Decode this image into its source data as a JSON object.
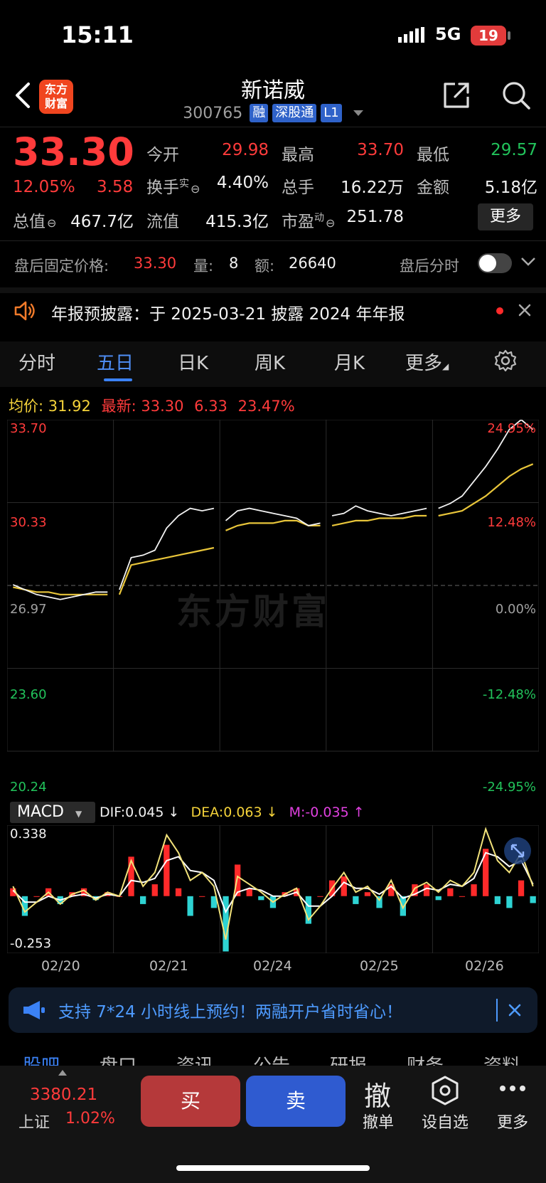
{
  "status_bar": {
    "time": "15:11",
    "network": "5G",
    "battery": "19"
  },
  "header": {
    "logo_line1": "东方",
    "logo_line2": "财富",
    "stock_name": "新诺威",
    "stock_code": "300765",
    "tags": [
      "融",
      "深股通",
      "L1"
    ]
  },
  "quote": {
    "price": "33.30",
    "pct_change": "12.05%",
    "abs_change": "3.58",
    "open_label": "今开",
    "open": "29.98",
    "high_label": "最高",
    "high": "33.70",
    "low_label": "最低",
    "low": "29.57",
    "turnover_label": "换手",
    "turnover_sup": "实",
    "turnover": "4.40%",
    "volume_label": "总手",
    "volume": "16.22万",
    "amount_label": "金额",
    "amount": "5.18亿",
    "mktcap_label": "总值",
    "mktcap": "467.7亿",
    "float_label": "流值",
    "float_cap": "415.3亿",
    "pe_label": "市盈",
    "pe_sup": "动",
    "pe": "251.78",
    "more_label": "更多"
  },
  "after_hours": {
    "price_label": "盘后固定价格:",
    "price": "33.30",
    "volume_label": "量:",
    "volume": "8",
    "amount_label": "额:",
    "amount": "26640",
    "toggle_label": "盘后分时"
  },
  "notice": {
    "text": "年报预披露：于 2025-03-21 披露 2024 年年报"
  },
  "chart_tabs": [
    "分时",
    "五日",
    "日K",
    "周K",
    "月K",
    "更多"
  ],
  "chart_info": {
    "avg_label": "均价:",
    "avg": "31.92",
    "latest_label": "最新:",
    "latest": "33.30",
    "latest_change": "6.33",
    "latest_pct": "23.47%"
  },
  "colors": {
    "up": "#ff3b3b",
    "down": "#22c35b",
    "avg_line": "#e8c53a",
    "dif_line": "#f2e27a",
    "dea_line": "#ffffff",
    "bar_pos": "#ff2a2a",
    "bar_neg": "#2ed3d3",
    "accent": "#3b82f6"
  },
  "chart_data": [
    {
      "type": "line",
      "title": "",
      "x": [
        "02/20",
        "02/21",
        "02/24",
        "02/25",
        "02/26"
      ],
      "ylim": [
        20.24,
        33.7
      ],
      "y_ticks_left": [
        "33.70",
        "30.33",
        "26.97",
        "23.60",
        "20.24"
      ],
      "y_ticks_right": [
        "24.95%",
        "12.48%",
        "0.00%",
        "-12.48%",
        "-24.95%"
      ],
      "watermark": "东方财富",
      "series": [
        {
          "values": [
            27.0,
            26.8,
            26.6,
            26.5,
            26.4,
            26.5,
            26.6,
            26.7,
            26.7,
            26.8,
            28.1,
            28.2,
            28.4,
            29.3,
            29.8,
            30.1,
            30.0,
            30.1,
            29.6,
            30.0,
            30.1,
            30.0,
            29.9,
            29.8,
            29.7,
            29.4,
            29.5,
            29.8,
            29.9,
            30.2,
            30.0,
            29.9,
            29.8,
            29.9,
            30.0,
            30.1,
            30.1,
            30.3,
            30.6,
            31.2,
            31.8,
            32.5,
            33.3,
            33.7,
            33.3
          ]
        },
        {
          "values": [
            26.9,
            26.8,
            26.7,
            26.7,
            26.6,
            26.6,
            26.6,
            26.6,
            26.6,
            26.6,
            27.8,
            27.9,
            28.0,
            28.1,
            28.2,
            28.3,
            28.4,
            28.5,
            29.2,
            29.4,
            29.5,
            29.5,
            29.5,
            29.6,
            29.6,
            29.4,
            29.4,
            29.4,
            29.5,
            29.6,
            29.6,
            29.7,
            29.7,
            29.7,
            29.8,
            29.8,
            29.8,
            29.9,
            30.0,
            30.3,
            30.6,
            31.0,
            31.4,
            31.7,
            31.9
          ]
        }
      ]
    },
    {
      "type": "bar",
      "title": "MACD",
      "ylim": [
        -0.253,
        0.338
      ],
      "y_ticks": [
        "0.338",
        "-0.253"
      ],
      "dif_label": "DIF:0.045 ↓",
      "dea_label": "DEA:0.063 ↓",
      "m_label": "M:-0.035 ↑",
      "series": [
        {
          "name": "DIF",
          "values": [
            0.05,
            -0.08,
            -0.03,
            0.02,
            -0.04,
            0.01,
            0.03,
            -0.02,
            0.02,
            0.0,
            0.18,
            0.05,
            0.12,
            0.31,
            0.22,
            0.08,
            0.12,
            0.05,
            -0.22,
            0.1,
            0.06,
            0.02,
            -0.03,
            0.01,
            0.04,
            -0.12,
            -0.05,
            0.04,
            0.12,
            0.02,
            0.05,
            -0.02,
            0.08,
            -0.06,
            0.04,
            0.07,
            0.02,
            0.08,
            0.05,
            0.12,
            0.34,
            0.18,
            0.12,
            0.22,
            0.05
          ]
        },
        {
          "name": "DEA",
          "values": [
            0.03,
            -0.03,
            -0.03,
            0.0,
            -0.02,
            0.0,
            0.01,
            -0.01,
            0.01,
            0.0,
            0.08,
            0.07,
            0.09,
            0.18,
            0.2,
            0.13,
            0.12,
            0.08,
            -0.08,
            0.02,
            0.04,
            0.03,
            0.0,
            0.0,
            0.02,
            -0.05,
            -0.05,
            0.0,
            0.07,
            0.04,
            0.04,
            0.01,
            0.05,
            -0.01,
            0.01,
            0.04,
            0.03,
            0.06,
            0.05,
            0.09,
            0.22,
            0.2,
            0.15,
            0.18,
            0.06
          ]
        },
        {
          "name": "M",
          "values": [
            0.04,
            -0.1,
            0.0,
            0.04,
            -0.04,
            0.02,
            0.04,
            -0.02,
            0.02,
            0.0,
            0.2,
            -0.04,
            0.06,
            0.26,
            0.04,
            -0.1,
            0.0,
            -0.06,
            -0.28,
            0.16,
            0.04,
            -0.02,
            -0.06,
            0.02,
            0.04,
            -0.14,
            0.0,
            0.08,
            0.1,
            -0.04,
            0.02,
            -0.06,
            0.06,
            -0.1,
            0.06,
            0.06,
            -0.02,
            0.04,
            0.0,
            0.06,
            0.24,
            -0.04,
            -0.06,
            0.08,
            -0.035
          ]
        }
      ]
    }
  ],
  "promo": {
    "text": "支持 7*24 小时线上预约！两融开户省时省心！"
  },
  "bottom_tabs": [
    "股吧",
    "盘口",
    "资讯",
    "公告",
    "研报",
    "财务",
    "资料"
  ],
  "bottom_bar": {
    "index_value": "3380.21",
    "index_name": "上证",
    "index_pct": "1.02%",
    "buy": "买",
    "sell": "卖",
    "cancel_glyph": "撤",
    "cancel": "撤单",
    "watchlist": "设自选",
    "more": "更多"
  }
}
